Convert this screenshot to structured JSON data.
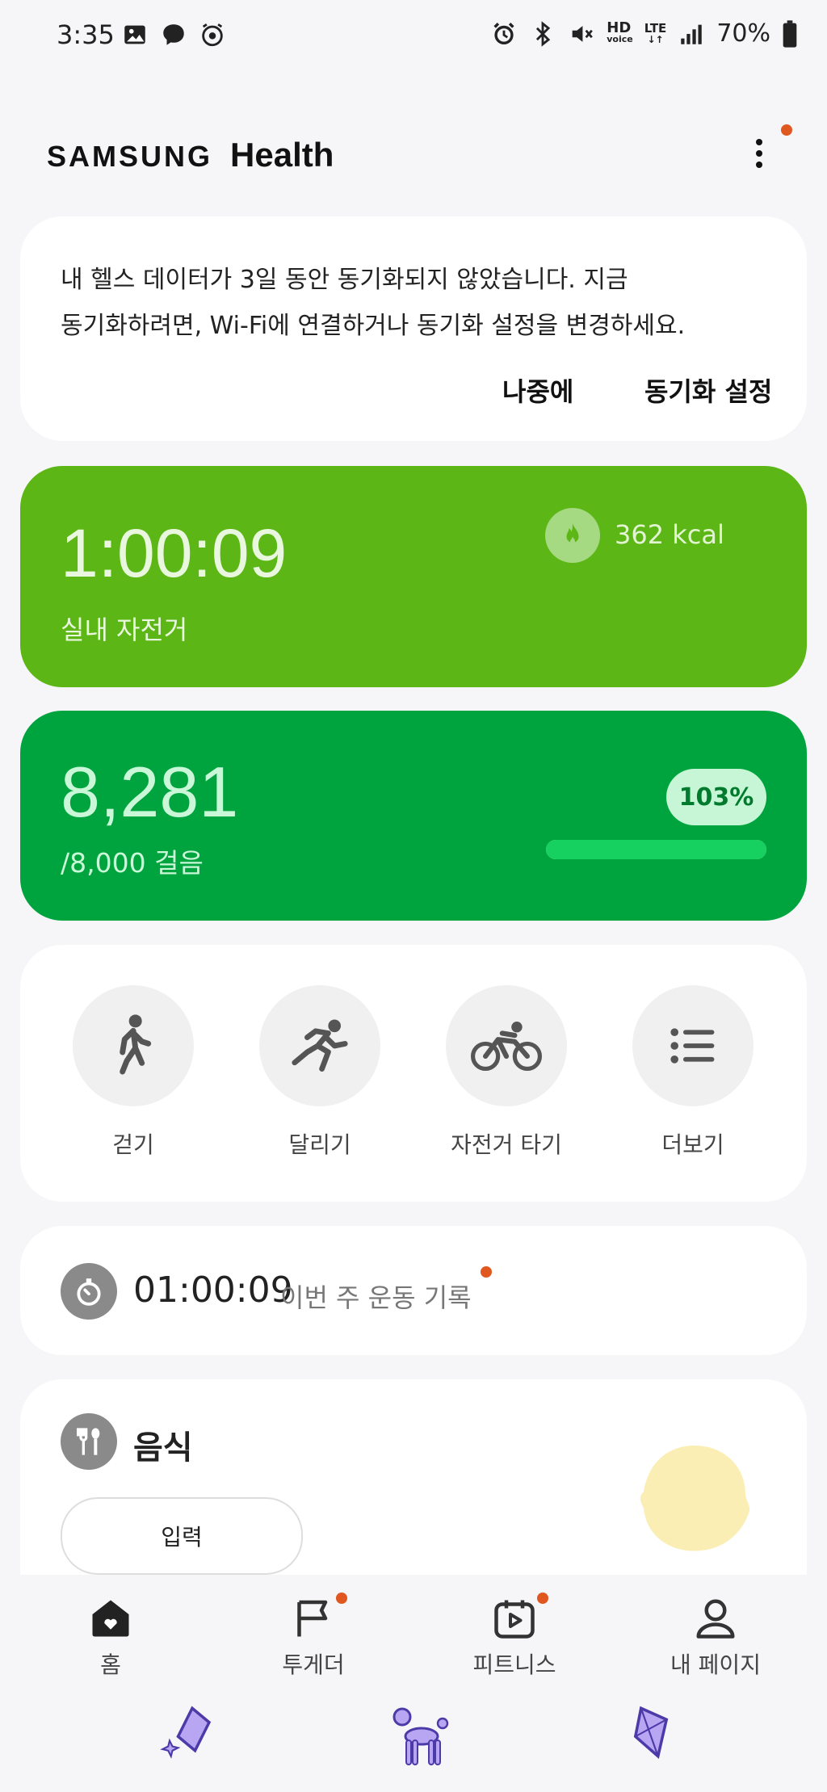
{
  "status_bar": {
    "time": "3:35",
    "left_icons": [
      "gallery-icon",
      "messenger-icon",
      "alarm-app-icon"
    ],
    "right_icons": [
      "alarm-icon",
      "bluetooth-icon",
      "mute-icon",
      "hd-voice-icon",
      "lte-icon",
      "signal-icon",
      "battery-icon"
    ],
    "hd": "HD",
    "voice": "voice",
    "lte": "LTE",
    "battery": "70%"
  },
  "header": {
    "brand_samsung": "SAMSUNG",
    "brand_health": "Health",
    "menu_icon": "more-vertical-icon"
  },
  "sync_card": {
    "message_line1": "내 헬스 데이터가 3일 동안 동기화되지 않았습니다. 지금",
    "message_line2": "동기화하려면, Wi-Fi에 연결하거나 동기화 설정을 변경하세요.",
    "later_label": "나중에",
    "settings_label": "동기화 설정"
  },
  "exercise_card": {
    "duration": "1:00:09",
    "activity": "실내 자전거",
    "calories": "362 kcal",
    "color": "#5cb716"
  },
  "steps_card": {
    "count": "8,281",
    "goal_text": "/8,000 걸음",
    "percent": "103%",
    "progress": 1.0,
    "color": "#00a43e"
  },
  "activities": [
    {
      "label": "걷기",
      "icon": "walking-icon"
    },
    {
      "label": "달리기",
      "icon": "running-icon"
    },
    {
      "label": "자전거 타기",
      "icon": "cycling-icon"
    },
    {
      "label": "더보기",
      "icon": "list-icon"
    }
  ],
  "weekly_record": {
    "time": "01:00:09",
    "label": "이번 주 운동 기록",
    "icon": "stopwatch-icon"
  },
  "food": {
    "title": "음식",
    "input_label": "입력",
    "icon": "fork-spoon-icon"
  },
  "bottom_nav": [
    {
      "label": "홈",
      "icon": "home-icon",
      "active": true
    },
    {
      "label": "투게더",
      "icon": "flag-icon",
      "badge": true
    },
    {
      "label": "피트니스",
      "icon": "fitness-calendar-icon",
      "badge": true
    },
    {
      "label": "내 페이지",
      "icon": "person-icon"
    }
  ],
  "accent_colors": {
    "notification_dot": "#e0571f",
    "background": "#f6f6f8"
  }
}
